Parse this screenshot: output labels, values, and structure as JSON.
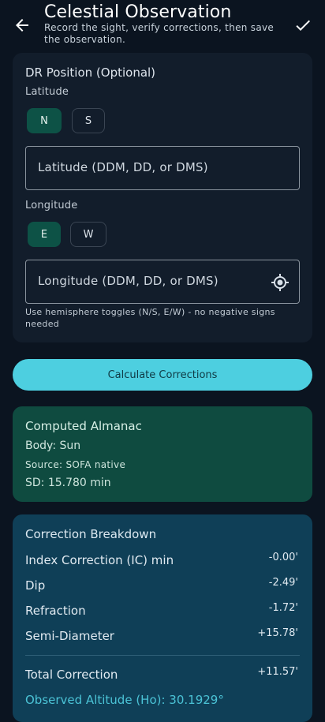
{
  "header": {
    "title": "Celestial Observation",
    "subtitle": "Record the sight, verify corrections, then save the observation."
  },
  "dr_position": {
    "heading": "DR Position (Optional)",
    "latitude_label": "Latitude",
    "lat_north": "N",
    "lat_south": "S",
    "latitude_placeholder": "Latitude (DDM, DD, or DMS)",
    "longitude_label": "Longitude",
    "lon_east": "E",
    "lon_west": "W",
    "longitude_placeholder": "Longitude (DDM, DD, or DMS)",
    "helper": "Use hemisphere toggles (N/S, E/W) - no negative signs needed"
  },
  "calculate_label": "Calculate Corrections",
  "almanac": {
    "heading": "Computed Almanac",
    "body": "Body: Sun",
    "source": "Source: SOFA native",
    "sd": "SD: 15.780 min"
  },
  "corrections": {
    "heading": "Correction Breakdown",
    "rows": [
      {
        "label": "Index Correction (IC) min",
        "value": "-0.00'"
      },
      {
        "label": "Dip",
        "value": "-2.49'"
      },
      {
        "label": "Refraction",
        "value": "-1.72'"
      },
      {
        "label": "Semi-Diameter",
        "value": "+15.78'"
      }
    ],
    "total_label": "Total Correction",
    "total_value": "+11.57'",
    "observed_altitude": "Observed Altitude (Ho): 30.1929°"
  },
  "colors": {
    "background": "#0b1420",
    "accent": "#4dcfe0",
    "toggle_selected": "#0d5246",
    "almanac_card": "#0f4b40",
    "corrections_card": "#0f3f57"
  }
}
